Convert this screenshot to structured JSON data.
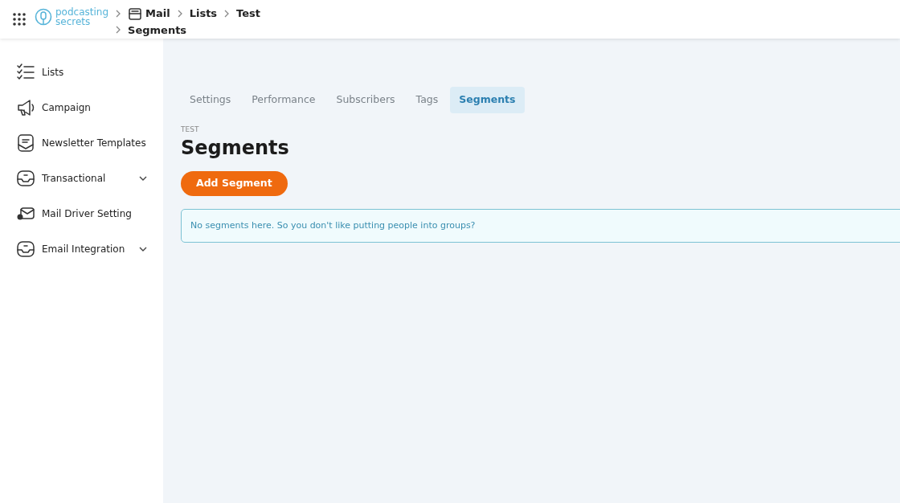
{
  "logo": {
    "line_1": "podcasting",
    "line_2": "secrets"
  },
  "breadcrumb": [
    {
      "label": "Mail",
      "kind": "mail"
    },
    {
      "label": "Lists",
      "kind": "plain"
    },
    {
      "label": "Test",
      "kind": "plain"
    },
    {
      "label": "Segments",
      "kind": "wrap"
    }
  ],
  "sidebar": {
    "items": [
      {
        "label": "Lists",
        "expandable": false
      },
      {
        "label": "Campaign",
        "expandable": false
      },
      {
        "label": "Newsletter Templates",
        "expandable": false
      },
      {
        "label": "Transactional",
        "expandable": true
      },
      {
        "label": "Mail Driver Setting",
        "expandable": false
      },
      {
        "label": "Email Integration",
        "expandable": true
      }
    ]
  },
  "tabs": [
    {
      "label": "Settings",
      "selected": false
    },
    {
      "label": "Performance",
      "selected": false
    },
    {
      "label": "Subscribers",
      "selected": false
    },
    {
      "label": "Tags",
      "selected": false
    },
    {
      "label": "Segments",
      "selected": true
    }
  ],
  "page": {
    "eyebrow": "TEST",
    "title": "Segments"
  },
  "add_button": {
    "label": "Add Segment"
  },
  "alert": {
    "text": "No segments here. So you don't like putting people into groups?"
  }
}
